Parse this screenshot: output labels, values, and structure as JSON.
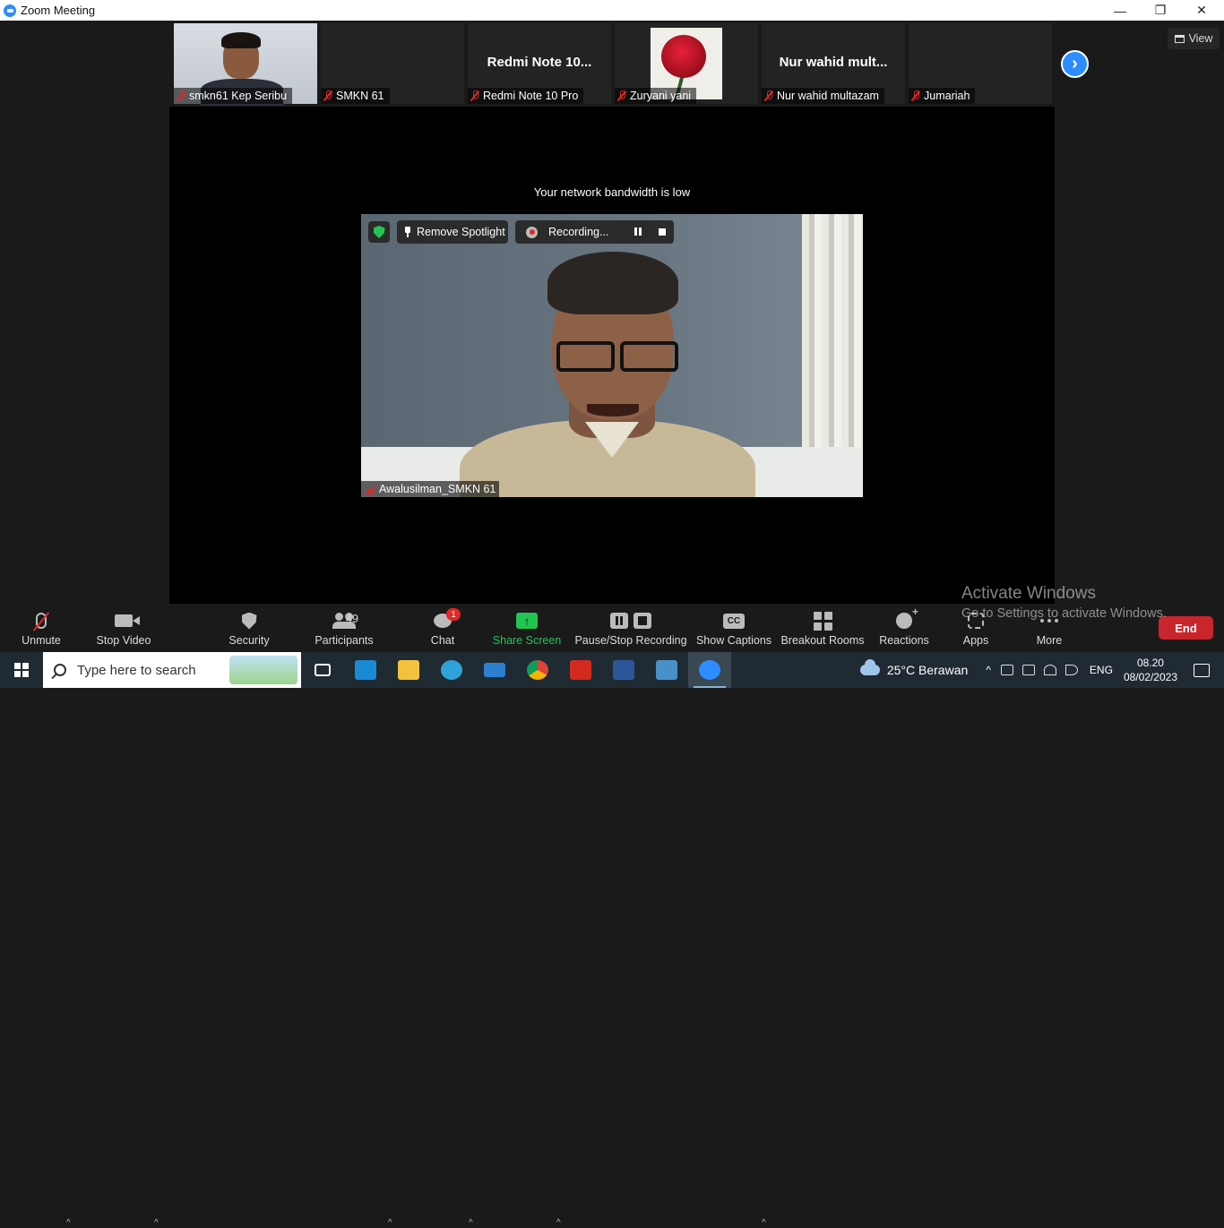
{
  "window": {
    "title": "Zoom Meeting",
    "controls": {
      "minimize": "—",
      "restore": "❐",
      "close": "✕"
    }
  },
  "thumbnails": [
    {
      "name": "smkn61 Kep Seribu",
      "display": "",
      "kind": "video-person"
    },
    {
      "name": "SMKN 61",
      "display": "",
      "kind": "blank"
    },
    {
      "name": "Redmi Note 10 Pro",
      "display": "Redmi Note 10...",
      "kind": "name"
    },
    {
      "name": "Zuryani yani",
      "display": "",
      "kind": "rose-image"
    },
    {
      "name": "Nur wahid multazam",
      "display": "Nur wahid mult...",
      "kind": "name"
    },
    {
      "name": "Jumariah",
      "display": "",
      "kind": "blank"
    }
  ],
  "view_button": {
    "label": "View"
  },
  "next_page_icon": "chevron-right-icon",
  "stage": {
    "notice": "Your network bandwidth is low",
    "remove_spotlight_label": "Remove Spotlight",
    "recording_label": "Recording...",
    "speaker_name": "Awalusilman_SMKN 61"
  },
  "toolbar": {
    "unmute": "Unmute",
    "stop_video": "Stop Video",
    "security": "Security",
    "participants": "Participants",
    "participants_count": "49",
    "chat": "Chat",
    "chat_badge": "1",
    "share_screen": "Share Screen",
    "pause_stop_recording": "Pause/Stop Recording",
    "show_captions": "Show Captions",
    "captions_icon_text": "CC",
    "breakout_rooms": "Breakout Rooms",
    "reactions": "Reactions",
    "apps": "Apps",
    "more": "More",
    "end": "End"
  },
  "watermark": {
    "line1": "Activate Windows",
    "line2": "Go to Settings to activate Windows."
  },
  "taskbar": {
    "search_placeholder": "Type here to search",
    "weather": "25°C  Berawan",
    "language": "ENG",
    "time": "08.20",
    "date": "08/02/2023",
    "apps": [
      {
        "name": "task-view",
        "color": "#1f2a33"
      },
      {
        "name": "microsoft-store",
        "color": "#1a8ad4"
      },
      {
        "name": "file-explorer",
        "color": "#f3c23c"
      },
      {
        "name": "edge",
        "color": "#2fa3d9"
      },
      {
        "name": "mail",
        "color": "#2f7fd0"
      },
      {
        "name": "chrome",
        "color": "#db4437"
      },
      {
        "name": "acrobat",
        "color": "#d32a1e"
      },
      {
        "name": "word",
        "color": "#2b579a"
      },
      {
        "name": "control-panel",
        "color": "#4a90c8"
      },
      {
        "name": "zoom",
        "color": "#2d8cff"
      }
    ]
  },
  "colors": {
    "zoom_blue": "#2d8cff",
    "share_green": "#23c552",
    "end_red": "#c9252c",
    "muted_red": "#e02828"
  }
}
